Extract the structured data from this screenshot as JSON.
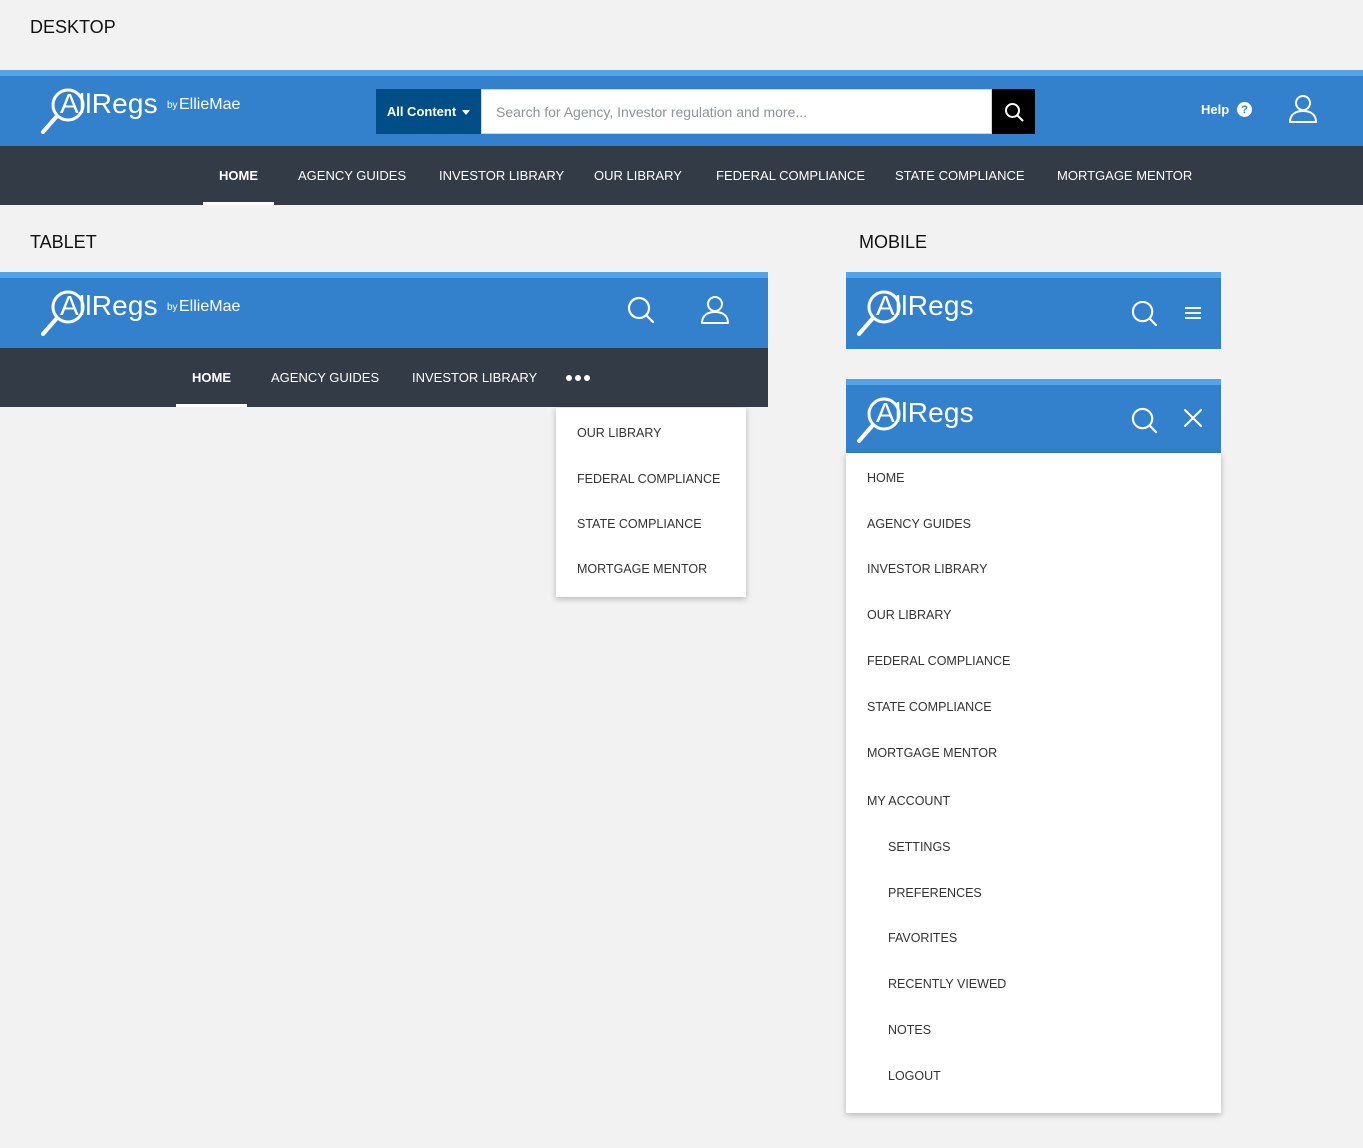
{
  "labels": {
    "desktop": "DESKTOP",
    "tablet": "TABLET",
    "mobile": "MOBILE"
  },
  "colors": {
    "brand_blue": "#3380cc",
    "accent_strip": "#52a3e8",
    "nav_dark": "#333b46",
    "scope_button": "#004e85"
  },
  "logo": {
    "text": "AllRegs",
    "by": "by",
    "brand": "EllieMae"
  },
  "desktop": {
    "search": {
      "scope_label": "All Content",
      "placeholder": "Search for Agency, Investor regulation and more...",
      "value": ""
    },
    "help_label": "Help",
    "help_icon_glyph": "?",
    "icons": [
      "search-icon",
      "help-icon",
      "user-icon"
    ],
    "nav": [
      {
        "label": "HOME",
        "active": true
      },
      {
        "label": "AGENCY GUIDES"
      },
      {
        "label": "INVESTOR LIBRARY"
      },
      {
        "label": "OUR LIBRARY"
      },
      {
        "label": "FEDERAL COMPLIANCE"
      },
      {
        "label": "STATE COMPLIANCE"
      },
      {
        "label": "MORTGAGE MENTOR"
      }
    ]
  },
  "tablet": {
    "icons": [
      "search-icon",
      "user-icon",
      "more-icon"
    ],
    "nav": [
      {
        "label": "HOME",
        "active": true
      },
      {
        "label": "AGENCY GUIDES"
      },
      {
        "label": "INVESTOR LIBRARY"
      }
    ],
    "overflow_menu": [
      {
        "label": "OUR LIBRARY"
      },
      {
        "label": "FEDERAL COMPLIANCE"
      },
      {
        "label": "STATE COMPLIANCE"
      },
      {
        "label": "MORTGAGE MENTOR"
      }
    ]
  },
  "mobile": {
    "icons": [
      "search-icon",
      "menu-icon",
      "close-icon"
    ],
    "menu": [
      {
        "label": "HOME"
      },
      {
        "label": "AGENCY GUIDES"
      },
      {
        "label": "INVESTOR LIBRARY"
      },
      {
        "label": "OUR LIBRARY"
      },
      {
        "label": "FEDERAL COMPLIANCE"
      },
      {
        "label": "STATE COMPLIANCE"
      },
      {
        "label": "MORTGAGE MENTOR"
      },
      {
        "label": "MY ACCOUNT"
      }
    ],
    "account_menu": [
      {
        "label": "SETTINGS"
      },
      {
        "label": "PREFERENCES"
      },
      {
        "label": "FAVORITES"
      },
      {
        "label": "RECENTLY VIEWED"
      },
      {
        "label": "NOTES"
      },
      {
        "label": "LOGOUT"
      }
    ]
  }
}
